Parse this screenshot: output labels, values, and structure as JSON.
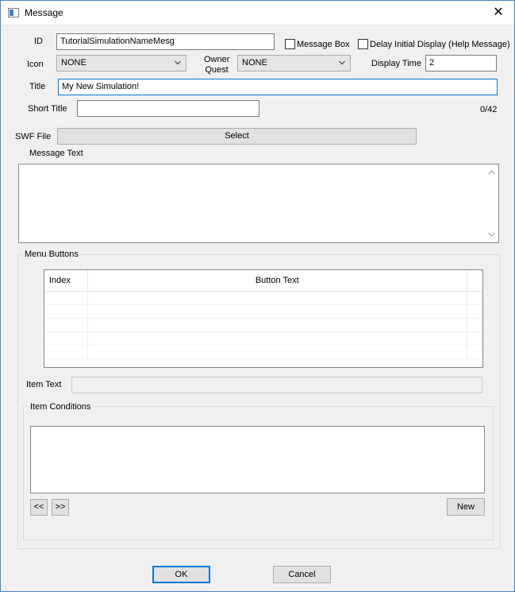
{
  "window": {
    "title": "Message",
    "close_glyph": "✕"
  },
  "form": {
    "id_label": "ID",
    "id_value": "TutorialSimulationNameMesg",
    "message_box_label": "Message Box",
    "message_box_checked": false,
    "delay_label": "Delay Initial Display (Help Message)",
    "delay_checked": false,
    "icon_label": "Icon",
    "icon_value": "NONE",
    "owner_quest_label_line1": "Owner",
    "owner_quest_label_line2": "Quest",
    "owner_quest_value": "NONE",
    "display_time_label": "Display Time",
    "display_time_value": "2",
    "title_label": "Title",
    "title_value": "My New Simulation!",
    "short_title_label": "Short Title",
    "short_title_value": "",
    "short_title_count": "0/42",
    "swf_label": "SWF File",
    "select_button": "Select",
    "message_text_label": "Message Text",
    "message_text_value": ""
  },
  "menu_buttons": {
    "group_title": "Menu Buttons",
    "columns": [
      "Index",
      "Button Text"
    ],
    "rows": [],
    "item_text_label": "Item Text",
    "item_text_value": ""
  },
  "item_conditions": {
    "group_title": "Item Conditions",
    "prev_button": "<<",
    "next_button": ">>",
    "new_button": "New"
  },
  "footer": {
    "ok_button": "OK",
    "cancel_button": "Cancel"
  },
  "colors": {
    "accent": "#0078d7",
    "window_border": "#4a86c8",
    "background": "#f0f0f0"
  }
}
